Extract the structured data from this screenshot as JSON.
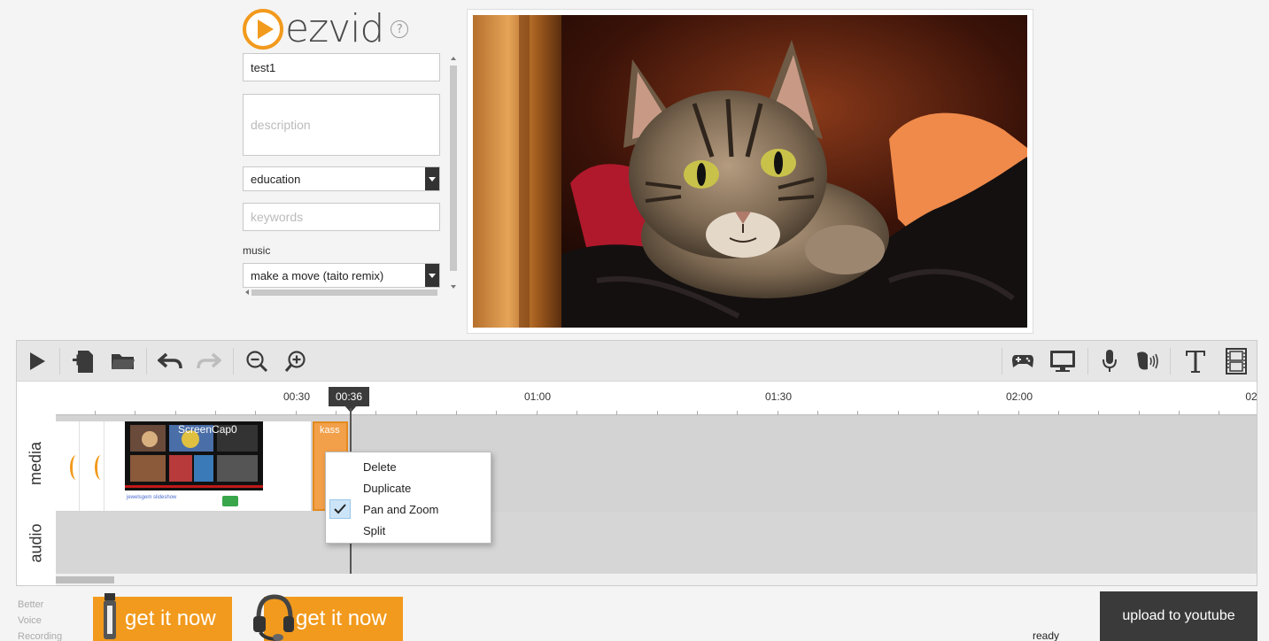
{
  "app": {
    "logo_text": "ezvid",
    "help_glyph": "?"
  },
  "form": {
    "title_value": "test1",
    "description_placeholder": "description",
    "category_value": "education",
    "keywords_placeholder": "keywords",
    "music_label": "music",
    "music_value": "make a move (taito remix)"
  },
  "toolbar": {
    "left_icons": [
      "play-icon",
      "add-media-icon",
      "open-folder-icon",
      "undo-icon",
      "redo-icon",
      "zoom-out-icon",
      "zoom-in-icon"
    ],
    "right_icons": [
      "gamepad-icon",
      "screen-capture-icon",
      "microphone-icon",
      "voice-synthesis-icon",
      "text-icon",
      "filmstrip-icon"
    ]
  },
  "timeline": {
    "ruler_labels": [
      "00:30",
      "01:00",
      "01:30",
      "02:00",
      "02"
    ],
    "playhead_time": "00:36",
    "tracks": [
      "media",
      "audio"
    ],
    "clips": {
      "screen_title": "ScreenCap0",
      "screen_caption": "jewelsgem slideshow",
      "cat_title": "kass"
    }
  },
  "context_menu": {
    "items": [
      {
        "label": "Delete",
        "checked": false
      },
      {
        "label": "Duplicate",
        "checked": false
      },
      {
        "label": "Pan and Zoom",
        "checked": true
      },
      {
        "label": "Split",
        "checked": false
      }
    ]
  },
  "footer": {
    "promo_lines": [
      "Better",
      "Voice",
      "Recording"
    ],
    "promo_button_1": "get it now",
    "promo_button_2": "get it now",
    "status": "ready",
    "upload_button": "upload to youtube"
  },
  "colors": {
    "accent": "#f29a1d",
    "dark_button": "#3a3a3a"
  }
}
